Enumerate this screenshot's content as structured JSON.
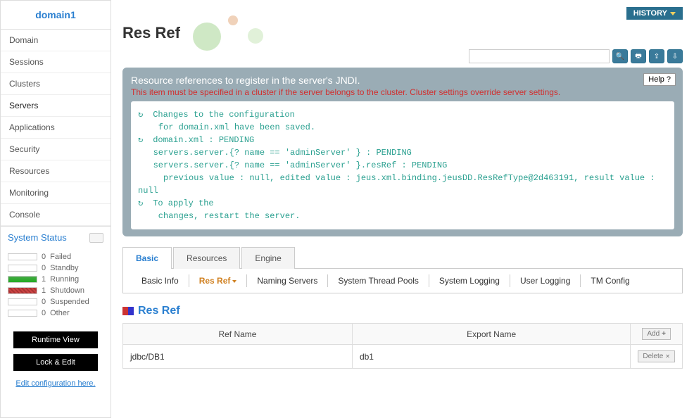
{
  "domain_title": "domain1",
  "nav": [
    {
      "label": "Domain"
    },
    {
      "label": "Sessions"
    },
    {
      "label": "Clusters"
    },
    {
      "label": "Servers"
    },
    {
      "label": "Applications"
    },
    {
      "label": "Security"
    },
    {
      "label": "Resources"
    },
    {
      "label": "Monitoring"
    },
    {
      "label": "Console"
    }
  ],
  "system_status": {
    "header": "System Status",
    "items": [
      {
        "count": "0",
        "label": "Failed",
        "color": ""
      },
      {
        "count": "0",
        "label": "Standby",
        "color": ""
      },
      {
        "count": "1",
        "label": "Running",
        "color": "green"
      },
      {
        "count": "1",
        "label": "Shutdown",
        "color": "red"
      },
      {
        "count": "0",
        "label": "Suspended",
        "color": ""
      },
      {
        "count": "0",
        "label": "Other",
        "color": ""
      }
    ]
  },
  "buttons": {
    "runtime_view": "Runtime View",
    "lock_edit": "Lock & Edit",
    "edit_config": "Edit configuration here."
  },
  "history_label": "HISTORY",
  "page_title": "Res Ref",
  "info": {
    "title": "Resource references to register in the server's JNDI.",
    "warning": "This item must be specified in a cluster if the server belongs to the cluster. Cluster settings override server settings.",
    "help_label": "Help",
    "code_lines": [
      "Changes to the configuration",
      "    for domain.xml have been saved.",
      "domain.xml : PENDING",
      "  servers.server.{? name == 'adminServer' } : PENDING",
      "  servers.server.{? name == 'adminServer' }.resRef : PENDING",
      "    previous value : null, edited value : jeus.xml.binding.jeusDD.ResRefType@2d463191, result value : null",
      "To apply the",
      "    changes, restart the server."
    ]
  },
  "main_tabs": [
    {
      "label": "Basic",
      "active": true
    },
    {
      "label": "Resources"
    },
    {
      "label": "Engine"
    }
  ],
  "sub_tabs": [
    {
      "label": "Basic Info"
    },
    {
      "label": "Res Ref",
      "active": true
    },
    {
      "label": "Naming Servers"
    },
    {
      "label": "System Thread Pools"
    },
    {
      "label": "System Logging"
    },
    {
      "label": "User Logging"
    },
    {
      "label": "TM Config"
    }
  ],
  "section_title": "Res Ref",
  "table": {
    "headers": [
      "Ref Name",
      "Export Name"
    ],
    "add_label": "Add",
    "delete_label": "Delete",
    "rows": [
      {
        "ref_name": "jdbc/DB1",
        "export_name": "db1"
      }
    ]
  }
}
